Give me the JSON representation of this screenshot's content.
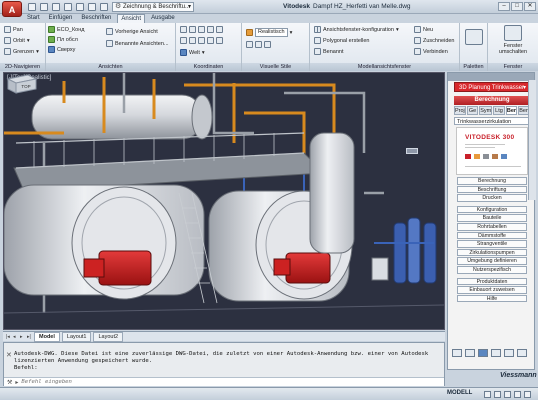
{
  "titlebar": {
    "app_button": "A",
    "workspace": "Zeichnung & Beschriftu...",
    "app_name": "Vitodesk",
    "document": "Dampf HZ_Herfetti van Melle.dwg"
  },
  "ribbon_tabs": [
    "Start",
    "Einfügen",
    "Beschriften",
    "Ansicht",
    "Ausgabe"
  ],
  "ribbon_active_tab": "Ansicht",
  "ribbon": {
    "nav2d": {
      "title": "2D-Navigieren",
      "items": [
        "Pan",
        "Orbit",
        "Grenzen"
      ]
    },
    "ansichten": {
      "title": "Ansichten",
      "items": [
        "ECO_Конд",
        "Пл обсл",
        "Сверху"
      ],
      "commands": [
        "Vorherige Ansicht",
        "Benannte Ansichten..."
      ]
    },
    "koordinaten": {
      "title": "Koordinaten",
      "items": [
        "Welt"
      ]
    },
    "visuelle_stile": {
      "title": "Visuelle Stile",
      "style": "Realistisch"
    },
    "modellansicht": {
      "title": "Modellansichtsfenster",
      "items": [
        "Ansichtsfenster-konfiguration",
        "Polygonal erstellen",
        "Benannt"
      ],
      "actions": [
        "Neu",
        "Zuschneiden",
        "Verbinden"
      ]
    },
    "paletten": {
      "title": "Paletten"
    },
    "fenster": {
      "title": "Fenster",
      "button": "Fenster umschalten"
    }
  },
  "viewport": {
    "label": "[-][Top][Realistic]",
    "viewcube_label": "TOP"
  },
  "layout_tabs": [
    "Model",
    "Layout1",
    "Layout2"
  ],
  "layout_active": "Model",
  "command": {
    "history": [
      "Autodesk-DWG. Diese Datei ist eine zuverlässige DWG-Datei, die zuletzt von einer Autodesk-Anwendung bzw. einer von Autodesk",
      "lizenzierten Anwendung gespeichert wurde.",
      "Befehl:"
    ],
    "placeholder": "Befehl eingeben"
  },
  "status": {
    "mode": "MODELL"
  },
  "palette": {
    "dropdown": "3D Planung Trinkwasser",
    "section": "Berechnung",
    "tabs": [
      "Proj",
      "Ge",
      "Sym",
      "Ltg",
      "Ber",
      "Ben"
    ],
    "active_tab": "Ber",
    "calc_type": "Trinkwasserzirkulation",
    "preview_logo": "VITODESK 300",
    "buttons": [
      "Berechnung",
      "Beschriftung",
      "Drucken",
      "Konfiguration",
      "Bauteile",
      "Rohrtabellen",
      "Dämmstoffe",
      "Strangventile",
      "Zirkulationspumpen",
      "Umgebung definieren",
      "Nutzerspezifisch",
      "Produktdaten",
      "Einbauort zuweisen",
      "Hilfe"
    ],
    "gap_before": [
      3,
      11
    ]
  },
  "brand": "Viessmann",
  "colors": {
    "accent_red": "#d8282c",
    "ribbon_bg": "#e6ebf1",
    "viewport_bg": "#2c3040"
  }
}
